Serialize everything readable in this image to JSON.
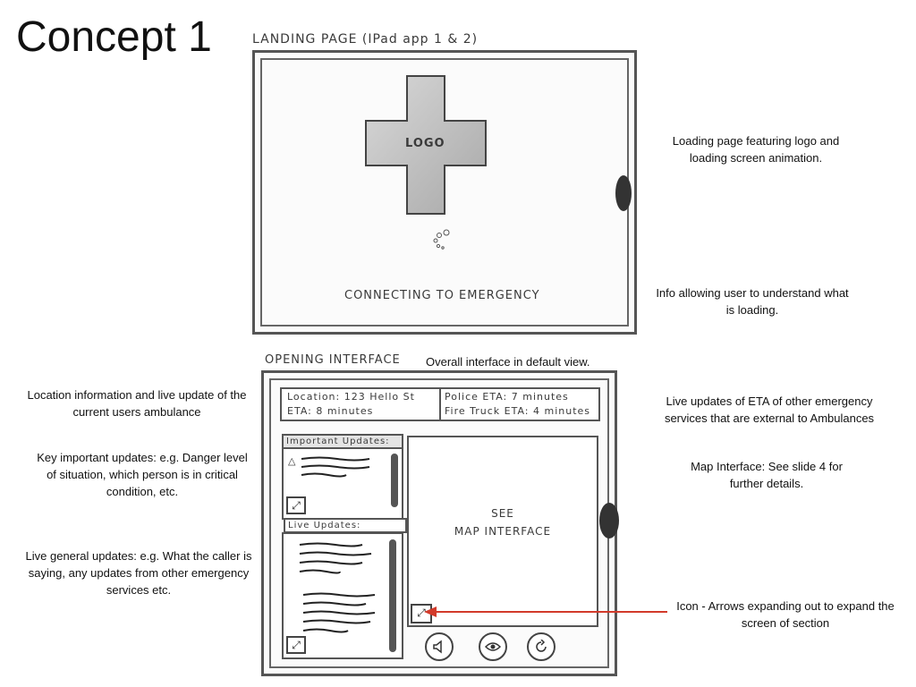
{
  "page_title": "Concept 1",
  "landing": {
    "label": "LANDING PAGE (IPad app 1 & 2)",
    "logo_text": "LOGO",
    "connecting_text": "CONNECTING TO EMERGENCY"
  },
  "opening": {
    "label": "OPENING INTERFACE",
    "label_caption": "Overall interface in default view.",
    "location": "Location: 123 Hello St",
    "eta": "ETA: 8 minutes",
    "police_eta": "Police ETA: 7 minutes",
    "fire_eta": "Fire Truck ETA: 4 minutes",
    "important_updates": "Important Updates:",
    "live_updates": "Live Updates:",
    "map_text_line1": "SEE",
    "map_text_line2": "MAP INTERFACE"
  },
  "annotations": {
    "loading_page": "Loading page featuring logo and loading screen animation.",
    "info_loading": "Info allowing user to understand what is loading.",
    "location_info": "Location information and live update of the current users ambulance",
    "key_updates": "Key important updates: e.g. Danger level of situation, which person is in critical condition, etc.",
    "live_general": "Live general updates: e.g. What the caller is saying, any updates from other emergency services etc.",
    "eta_updates": "Live updates of ETA of other emergency services that are external to Ambulances",
    "map_interface": "Map Interface: See slide 4 for further details.",
    "icon_expand": "Icon - Arrows expanding out to expand the screen of section"
  },
  "colors": {
    "arrow": "#d23a2a",
    "pencil": "#555555"
  },
  "icons": [
    "expand-arrows-icon",
    "speaker-icon",
    "eye-icon",
    "refresh-icon",
    "warning-icon"
  ]
}
